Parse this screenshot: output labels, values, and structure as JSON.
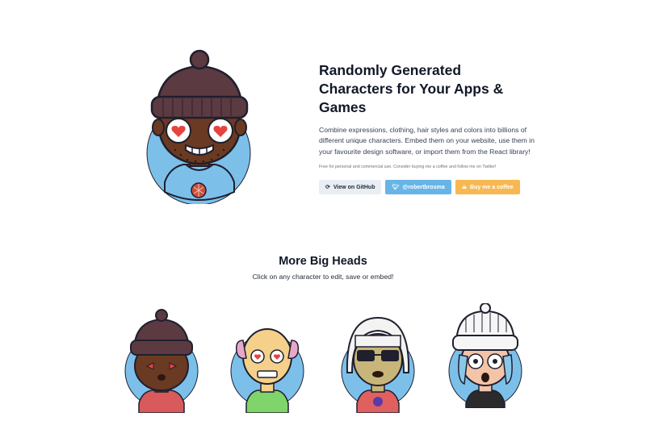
{
  "hero": {
    "title": "Randomly Generated Characters for Your Apps & Games",
    "description": "Combine expressions, clothing, hair styles and colors into billions of different unique characters. Embed them on your website, use them in your favourite design software, or import them from the React library!",
    "note": "Free for personal and commercial use. Consider buying me a coffee and follow me on Twitter!",
    "buttons": {
      "github": {
        "label": "View on GitHub",
        "icon": "github-icon"
      },
      "twitter": {
        "label": "@robertbrosma",
        "icon": "twitter-icon"
      },
      "coffee": {
        "label": "Buy me a coffee",
        "icon": "coffee-icon"
      }
    }
  },
  "more": {
    "title": "More Big Heads",
    "subtitle": "Click on any character to edit, save or embed!"
  },
  "colors": {
    "circle_bg": "#7cc0ea",
    "beanie_dark": "#5b3a42",
    "skin_dark": "#6b3a22",
    "twitter": "#67b4e7",
    "coffee": "#f7b852"
  }
}
